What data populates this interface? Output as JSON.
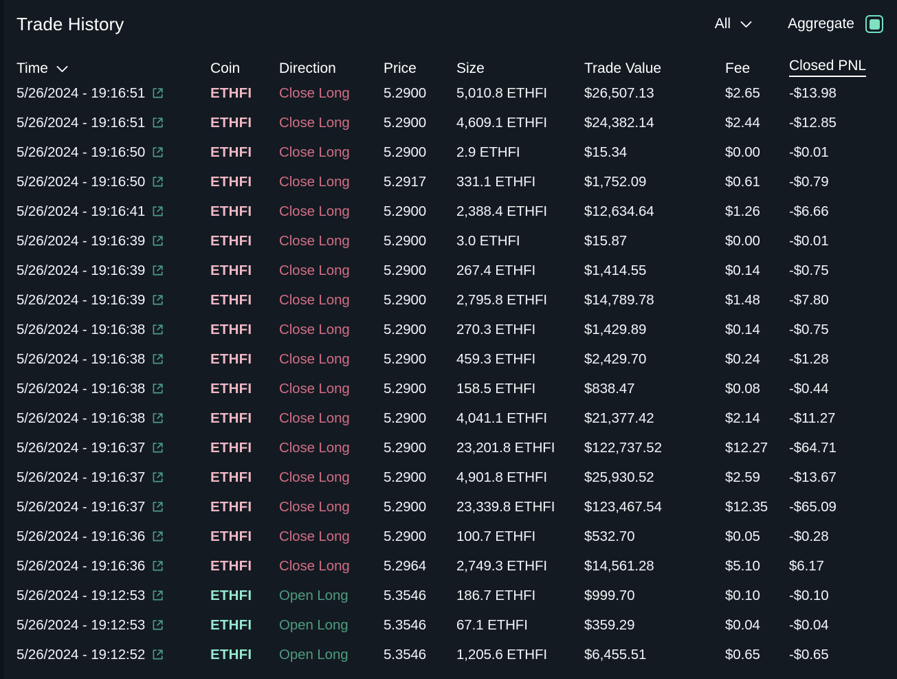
{
  "header": {
    "title": "Trade History",
    "filter_label": "All",
    "filter_chevron_icon": "chevron-down-icon",
    "aggregate_label": "Aggregate",
    "aggregate_checked": true,
    "accent_color": "#7fe0c2",
    "background_color": "#131a22"
  },
  "columns": {
    "time": "Time",
    "coin": "Coin",
    "direction": "Direction",
    "price": "Price",
    "size": "Size",
    "trade_value": "Trade Value",
    "fee": "Fee",
    "closed_pnl": "Closed PNL"
  },
  "sort": {
    "time_chevron_icon": "chevron-down-icon",
    "active_column": "Closed PNL"
  },
  "row_icon": "external-link-icon",
  "rows": [
    {
      "time": "5/26/2024 - 19:16:51",
      "coin": "ETHFI",
      "direction": "Close Long",
      "side": "close",
      "price": "5.2900",
      "size": "5,010.8 ETHFI",
      "trade_value": "$26,507.13",
      "fee": "$2.65",
      "pnl": "-$13.98"
    },
    {
      "time": "5/26/2024 - 19:16:51",
      "coin": "ETHFI",
      "direction": "Close Long",
      "side": "close",
      "price": "5.2900",
      "size": "4,609.1 ETHFI",
      "trade_value": "$24,382.14",
      "fee": "$2.44",
      "pnl": "-$12.85"
    },
    {
      "time": "5/26/2024 - 19:16:50",
      "coin": "ETHFI",
      "direction": "Close Long",
      "side": "close",
      "price": "5.2900",
      "size": "2.9 ETHFI",
      "trade_value": "$15.34",
      "fee": "$0.00",
      "pnl": "-$0.01"
    },
    {
      "time": "5/26/2024 - 19:16:50",
      "coin": "ETHFI",
      "direction": "Close Long",
      "side": "close",
      "price": "5.2917",
      "size": "331.1 ETHFI",
      "trade_value": "$1,752.09",
      "fee": "$0.61",
      "pnl": "-$0.79"
    },
    {
      "time": "5/26/2024 - 19:16:41",
      "coin": "ETHFI",
      "direction": "Close Long",
      "side": "close",
      "price": "5.2900",
      "size": "2,388.4 ETHFI",
      "trade_value": "$12,634.64",
      "fee": "$1.26",
      "pnl": "-$6.66"
    },
    {
      "time": "5/26/2024 - 19:16:39",
      "coin": "ETHFI",
      "direction": "Close Long",
      "side": "close",
      "price": "5.2900",
      "size": "3.0 ETHFI",
      "trade_value": "$15.87",
      "fee": "$0.00",
      "pnl": "-$0.01"
    },
    {
      "time": "5/26/2024 - 19:16:39",
      "coin": "ETHFI",
      "direction": "Close Long",
      "side": "close",
      "price": "5.2900",
      "size": "267.4 ETHFI",
      "trade_value": "$1,414.55",
      "fee": "$0.14",
      "pnl": "-$0.75"
    },
    {
      "time": "5/26/2024 - 19:16:39",
      "coin": "ETHFI",
      "direction": "Close Long",
      "side": "close",
      "price": "5.2900",
      "size": "2,795.8 ETHFI",
      "trade_value": "$14,789.78",
      "fee": "$1.48",
      "pnl": "-$7.80"
    },
    {
      "time": "5/26/2024 - 19:16:38",
      "coin": "ETHFI",
      "direction": "Close Long",
      "side": "close",
      "price": "5.2900",
      "size": "270.3 ETHFI",
      "trade_value": "$1,429.89",
      "fee": "$0.14",
      "pnl": "-$0.75"
    },
    {
      "time": "5/26/2024 - 19:16:38",
      "coin": "ETHFI",
      "direction": "Close Long",
      "side": "close",
      "price": "5.2900",
      "size": "459.3 ETHFI",
      "trade_value": "$2,429.70",
      "fee": "$0.24",
      "pnl": "-$1.28"
    },
    {
      "time": "5/26/2024 - 19:16:38",
      "coin": "ETHFI",
      "direction": "Close Long",
      "side": "close",
      "price": "5.2900",
      "size": "158.5 ETHFI",
      "trade_value": "$838.47",
      "fee": "$0.08",
      "pnl": "-$0.44"
    },
    {
      "time": "5/26/2024 - 19:16:38",
      "coin": "ETHFI",
      "direction": "Close Long",
      "side": "close",
      "price": "5.2900",
      "size": "4,041.1 ETHFI",
      "trade_value": "$21,377.42",
      "fee": "$2.14",
      "pnl": "-$11.27"
    },
    {
      "time": "5/26/2024 - 19:16:37",
      "coin": "ETHFI",
      "direction": "Close Long",
      "side": "close",
      "price": "5.2900",
      "size": "23,201.8 ETHFI",
      "trade_value": "$122,737.52",
      "fee": "$12.27",
      "pnl": "-$64.71"
    },
    {
      "time": "5/26/2024 - 19:16:37",
      "coin": "ETHFI",
      "direction": "Close Long",
      "side": "close",
      "price": "5.2900",
      "size": "4,901.8 ETHFI",
      "trade_value": "$25,930.52",
      "fee": "$2.59",
      "pnl": "-$13.67"
    },
    {
      "time": "5/26/2024 - 19:16:37",
      "coin": "ETHFI",
      "direction": "Close Long",
      "side": "close",
      "price": "5.2900",
      "size": "23,339.8 ETHFI",
      "trade_value": "$123,467.54",
      "fee": "$12.35",
      "pnl": "-$65.09"
    },
    {
      "time": "5/26/2024 - 19:16:36",
      "coin": "ETHFI",
      "direction": "Close Long",
      "side": "close",
      "price": "5.2900",
      "size": "100.7 ETHFI",
      "trade_value": "$532.70",
      "fee": "$0.05",
      "pnl": "-$0.28"
    },
    {
      "time": "5/26/2024 - 19:16:36",
      "coin": "ETHFI",
      "direction": "Close Long",
      "side": "close",
      "price": "5.2964",
      "size": "2,749.3 ETHFI",
      "trade_value": "$14,561.28",
      "fee": "$5.10",
      "pnl": "$6.17"
    },
    {
      "time": "5/26/2024 - 19:12:53",
      "coin": "ETHFI",
      "direction": "Open Long",
      "side": "open",
      "price": "5.3546",
      "size": "186.7 ETHFI",
      "trade_value": "$999.70",
      "fee": "$0.10",
      "pnl": "-$0.10"
    },
    {
      "time": "5/26/2024 - 19:12:53",
      "coin": "ETHFI",
      "direction": "Open Long",
      "side": "open",
      "price": "5.3546",
      "size": "67.1 ETHFI",
      "trade_value": "$359.29",
      "fee": "$0.04",
      "pnl": "-$0.04"
    },
    {
      "time": "5/26/2024 - 19:12:52",
      "coin": "ETHFI",
      "direction": "Open Long",
      "side": "open",
      "price": "5.3546",
      "size": "1,205.6 ETHFI",
      "trade_value": "$6,455.51",
      "fee": "$0.65",
      "pnl": "-$0.65"
    }
  ]
}
